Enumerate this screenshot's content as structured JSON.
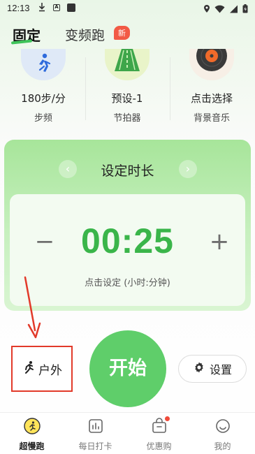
{
  "status_bar": {
    "time": "12:13"
  },
  "tabs": {
    "fixed": "固定",
    "variable": "变频跑",
    "new_badge": "新"
  },
  "tools": [
    {
      "value": "180步/分",
      "label": "步频",
      "icon": "running-figure-icon"
    },
    {
      "value": "预设-1",
      "label": "节拍器",
      "icon": "track-icon"
    },
    {
      "value": "点击选择",
      "label": "背景音乐",
      "icon": "vinyl-record-icon"
    }
  ],
  "timer": {
    "title": "设定时长",
    "value": "00:25",
    "hint": "点击设定 (小时:分钟)",
    "minus": "−",
    "plus": "+"
  },
  "actions": {
    "outdoor": "户外",
    "start": "开始",
    "settings": "设置"
  },
  "bottom_nav": [
    {
      "label": "超慢跑",
      "active": true
    },
    {
      "label": "每日打卡",
      "active": false
    },
    {
      "label": "优惠购",
      "active": false
    },
    {
      "label": "我的",
      "active": false
    }
  ],
  "colors": {
    "accent_green": "#3ab54a",
    "start_green": "#5fce6a",
    "badge_red": "#f25a45",
    "annotation_red": "#e23a2a"
  }
}
